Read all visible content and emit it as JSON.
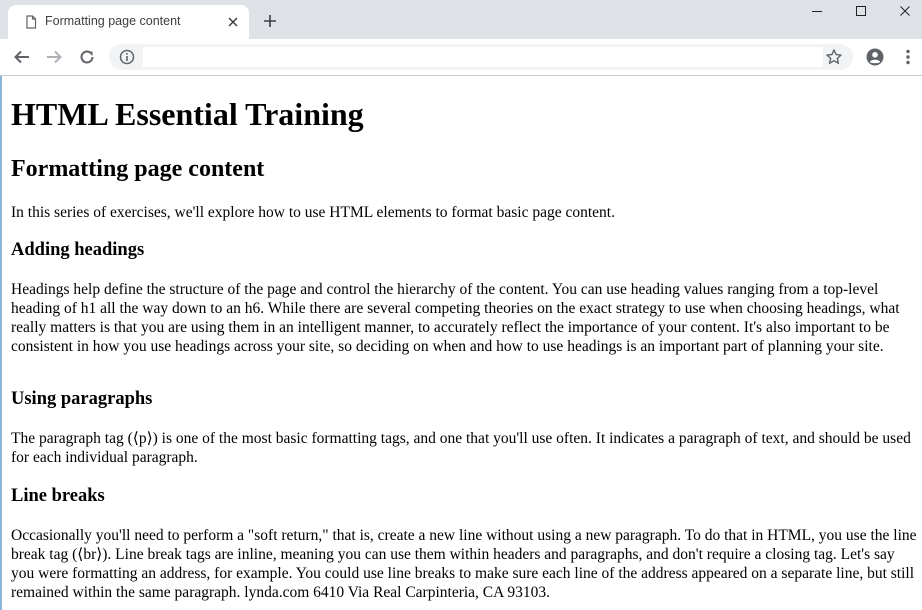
{
  "browser": {
    "tab_title": "Formatting page content",
    "address_value": ""
  },
  "page": {
    "site_title": "HTML Essential Training",
    "page_heading": "Formatting page content",
    "intro": "In this series of exercises, we'll explore how to use HTML elements to format basic page content.",
    "sections": [
      {
        "heading": "Adding headings",
        "body": "Headings help define the structure of the page and control the hierarchy of the content. You can use heading values ranging from a top-level heading of h1 all the way down to an h6. While there are several competing theories on the exact strategy to use when choosing headings, what really matters is that you are using them in an intelligent manner, to accurately reflect the importance of your content. It's also important to be consistent in how you use headings across your site, so deciding on when and how to use headings is an important part of planning your site."
      },
      {
        "heading": "Using paragraphs",
        "body": "The paragraph tag (⟨p⟩) is one of the most basic formatting tags, and one that you'll use often. It indicates a paragraph of text, and should be used for each individual paragraph."
      },
      {
        "heading": "Line breaks",
        "body": "Occasionally you'll need to perform a \"soft return,\" that is, create a new line without using a new paragraph. To do that in HTML, you use the line break tag (⟨br⟩). Line break tags are inline, meaning you can use them within headers and paragraphs, and don't require a closing tag. Let's say you were formatting an address, for example. You could use line breaks to make sure each line of the address appeared on a separate line, but still remained within the same paragraph. lynda.com 6410 Via Real Carpinteria, CA 93103."
      }
    ]
  },
  "icons": {
    "tab_favicon": "document-icon",
    "tab_close": "close-icon",
    "new_tab": "plus-icon",
    "minimize": "minimize-icon",
    "maximize": "maximize-icon",
    "close_window": "close-icon",
    "back": "arrow-left-icon",
    "forward": "arrow-right-icon",
    "reload": "reload-icon",
    "site_info": "info-icon",
    "bookmark": "star-icon",
    "account": "account-icon",
    "menu": "more-vertical-icon"
  },
  "colors": {
    "titlebar_bg": "#dee1e6",
    "omnibox_bg": "#f1f3f4",
    "icon_color": "#5f6368",
    "text_color": "#000000"
  }
}
